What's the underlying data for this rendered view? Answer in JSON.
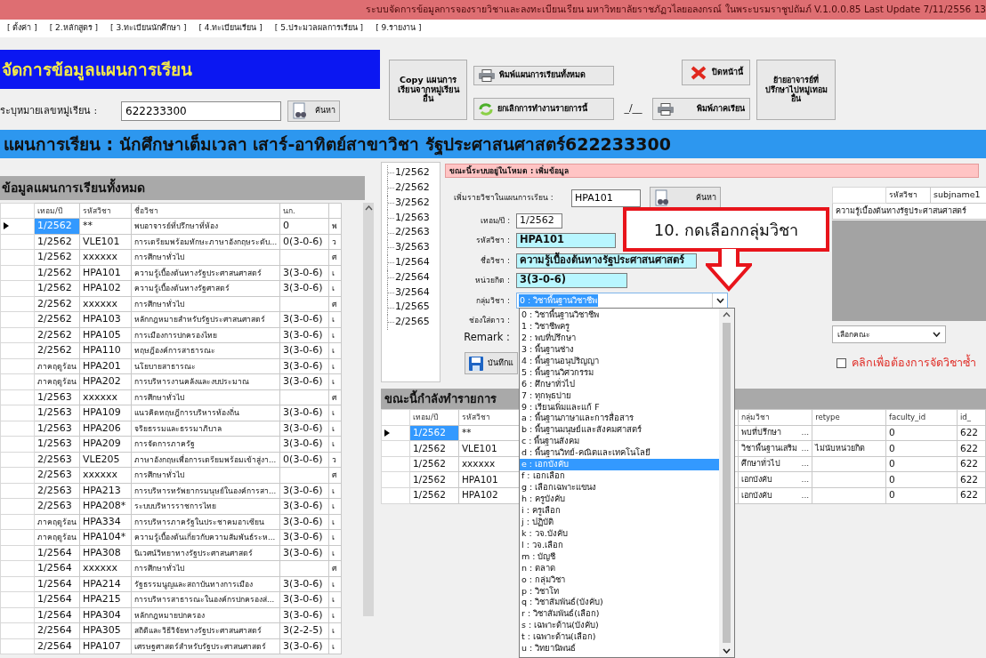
{
  "window": {
    "title": "ระบบจัดการข้อมูลการจองรายวิชาและลงทะเบียนเรียน มหาวิทยาลัยราชภัฏวไลยอลงกรณ์ ในพระบรมราชูปถัมภ์ V.1.0.0.85 Last Update 7/11/2556 13"
  },
  "menu": [
    "[ ตั้งค่า ]",
    "[ 2.หลักสูตร ]",
    "[ 3.ทะเบียนนักศึกษา ]",
    "[ 4.ทะเบียนเรียน ]",
    "[ 5.ประมวลผลการเรียน ]",
    "[ 9.รายงาน ]"
  ],
  "page_title": "จัดการข้อมูลแผนการเรียน",
  "group_search": {
    "label": "ระบุหมายเลขหมู่เรียน :",
    "value": "622233300",
    "button": "ค้นหา"
  },
  "toolbar": [
    {
      "kind": "copy",
      "label": "Copy แผนการเรียนจากหมู่เรียนอื่น"
    },
    {
      "kind": "print_all",
      "label": "พิมพ์แผนการเรียนทั้งหมด"
    },
    {
      "kind": "close",
      "label": "ปิดหน้านี้"
    },
    {
      "kind": "move",
      "label": "ย้ายอาจารย์ที่ปรึกษาไปหมู่เทอมอื่น"
    },
    {
      "kind": "cancel",
      "label": "ยกเลิกการทำงานรายการนี้"
    },
    {
      "kind": "record",
      "label": "_/__"
    },
    {
      "kind": "print_term",
      "label": "พิมพ์ภาคเรียน"
    }
  ],
  "plan_heading": "แผนการเรียน : นักศึกษาเต็มเวลา เสาร์-อาทิตย์สาขาวิชา รัฐประศาสนศาสตร์622233300",
  "all_plans": {
    "title": "ข้อมูลแผนการเรียนทั้งหมด",
    "columns": [
      "เทอม/ปี",
      "รหัสวิชา",
      "ชื่อวิชา",
      "นก."
    ],
    "rows": [
      {
        "selected": true,
        "term": "1/2562",
        "code": "**",
        "name": "พบอาจารย์ที่ปรึกษาที่ห้อง",
        "credits": "0",
        "column_5": "พ"
      },
      {
        "selected": false,
        "term": "1/2562",
        "code": "VLE101",
        "name": "การเตรียมพร้อมทักษะภาษาอังกฤษระดับ...",
        "credits": "0(3-0-6)",
        "column_5": "ว"
      },
      {
        "selected": false,
        "term": "1/2562",
        "code": "xxxxxx",
        "name": "การศึกษาทั่วไป",
        "column_5": "ศ"
      },
      {
        "selected": false,
        "term": "1/2562",
        "code": "HPA101",
        "name": "ความรู้เบื้องต้นทางรัฐประศาสนศาสตร์",
        "credits": "3(3-0-6)",
        "column_5": "เ"
      },
      {
        "selected": false,
        "term": "1/2562",
        "code": "HPA102",
        "name": "ความรู้เบื้องต้นทางรัฐศาสตร์",
        "credits": "3(3-0-6)",
        "column_5": "เ"
      },
      {
        "selected": false,
        "term": "2/2562",
        "code": "xxxxxx",
        "name": "การศึกษาทั่วไป",
        "column_5": "ศ"
      },
      {
        "selected": false,
        "term": "2/2562",
        "code": "HPA103",
        "name": "หลักกฎหมายสำหรับรัฐประศาสนศาสตร์",
        "credits": "3(3-0-6)",
        "column_5": "เ"
      },
      {
        "selected": false,
        "term": "2/2562",
        "code": "HPA105",
        "name": "การเมืองการปกครองไทย",
        "credits": "3(3-0-6)",
        "column_5": "เ"
      },
      {
        "selected": false,
        "term": "2/2562",
        "code": "HPA110",
        "name": "ทฤษฎีองค์การสาธารณะ",
        "credits": "3(3-0-6)",
        "column_5": "เ"
      },
      {
        "selected": false,
        "term": "ภาคฤดูร้อน",
        "code": "HPA201",
        "name": "นโยบายสาธารณะ",
        "credits": "3(3-0-6)",
        "column_5": "เ"
      },
      {
        "selected": false,
        "term": "ภาคฤดูร้อน",
        "code": "HPA202",
        "name": "การบริหารงานคลังและงบประมาณ",
        "credits": "3(3-0-6)",
        "column_5": "เ"
      },
      {
        "selected": false,
        "term": "1/2563",
        "code": "xxxxxx",
        "name": "การศึกษาทั่วไป",
        "column_5": "ศ"
      },
      {
        "selected": false,
        "term": "1/2563",
        "code": "HPA109",
        "name": "แนวคิดทฤษฎีการบริหารท้องถิ่น",
        "credits": "3(3-0-6)",
        "column_5": "เ"
      },
      {
        "selected": false,
        "term": "1/2563",
        "code": "HPA206",
        "name": "จริยธรรมและธรรมาภิบาล",
        "credits": "3(3-0-6)",
        "column_5": "เ"
      },
      {
        "selected": false,
        "term": "1/2563",
        "code": "HPA209",
        "name": "การจัดการภาครัฐ",
        "credits": "3(3-0-6)",
        "column_5": "เ"
      },
      {
        "selected": false,
        "term": "2/2563",
        "code": "VLE205",
        "name": "ภาษาอังกฤษเพื่อการเตรียมพร้อมเข้าสู่งา...",
        "credits": "0(3-0-6)",
        "column_5": "ว"
      },
      {
        "selected": false,
        "term": "2/2563",
        "code": "xxxxxx",
        "name": "การศึกษาทั่วไป",
        "column_5": "ศ"
      },
      {
        "selected": false,
        "term": "2/2563",
        "code": "HPA213",
        "name": "การบริหารทรัพยากรมนุษย์ในองค์การสา...",
        "credits": "3(3-0-6)",
        "column_5": "เ"
      },
      {
        "selected": false,
        "term": "2/2563",
        "code": "HPA208*",
        "name": "ระบบบริหารราชการไทย",
        "credits": "3(3-0-6)",
        "column_5": "เ"
      },
      {
        "selected": false,
        "term": "ภาคฤดูร้อน",
        "code": "HPA334",
        "name": "การบริหารภาครัฐในประชาคมอาเซียน",
        "credits": "3(3-0-6)",
        "column_5": "เ"
      },
      {
        "selected": false,
        "term": "ภาคฤดูร้อน",
        "code": "HPA104*",
        "name": "ความรู้เบื้องต้นเกี่ยวกับความสัมพันธ์ระห...",
        "credits": "3(3-0-6)",
        "column_5": "เ"
      },
      {
        "selected": false,
        "term": "1/2564",
        "code": "HPA308",
        "name": "นิเวศน์วิทยาทางรัฐประศาสนศาสตร์",
        "credits": "3(3-0-6)",
        "column_5": "เ"
      },
      {
        "selected": false,
        "term": "1/2564",
        "code": "xxxxxx",
        "name": "การศึกษาทั่วไป",
        "column_5": "ศ"
      },
      {
        "selected": false,
        "term": "1/2564",
        "code": "HPA214",
        "name": "รัฐธรรมนูญและสถาบันทางการเมือง",
        "credits": "3(3-0-6)",
        "column_5": "เ"
      },
      {
        "selected": false,
        "term": "1/2564",
        "code": "HPA215",
        "name": "การบริหารสาธารณะในองค์กรปกครองส่...",
        "credits": "3(3-0-6)",
        "column_5": "เ"
      },
      {
        "selected": false,
        "term": "1/2564",
        "code": "HPA304",
        "name": "หลักกฎหมายปกครอง",
        "credits": "3(3-0-6)",
        "column_5": "เ"
      },
      {
        "selected": false,
        "term": "2/2564",
        "code": "HPA305",
        "name": "สถิติและวิธีวิจัยทางรัฐประศาสนศาสตร์",
        "credits": "3(2-2-5)",
        "column_5": "เ"
      },
      {
        "selected": false,
        "term": "2/2564",
        "code": "HPA107",
        "name": "เศรษฐศาสตร์สำหรับรัฐประศาสนศาสตร์",
        "credits": "3(3-0-6)",
        "column_5": "เ"
      }
    ]
  },
  "terms": [
    "1/2562",
    "2/2562",
    "3/2562",
    "1/2563",
    "2/2563",
    "3/2563",
    "1/2564",
    "2/2564",
    "3/2564",
    "1/2565",
    "2/2565"
  ],
  "mode_status": "ขณะนี้ระบบอยู่ในโหมด : เพิ่มข้อมูล",
  "form": {
    "add_label": "เพิ่มรายวิชาในแผนการเรียน :",
    "add_value": "HPA101",
    "search_button": "ค้นหา",
    "fields": [
      {
        "kind": "text",
        "label": "เทอม/ปี :",
        "value": "1/2562"
      },
      {
        "kind": "highlight",
        "label": "รหัสวิชา :",
        "value": "HPA101"
      },
      {
        "kind": "highlight",
        "label": "ชื่อวิชา :",
        "value": "ความรู้เบื้องต้นทางรัฐประศาสนศาสตร์"
      },
      {
        "kind": "highlight",
        "label": "หน่วยกิต :",
        "value": "3(3-0-6)"
      },
      {
        "kind": "select",
        "label": "กลุ่มวิชา :",
        "value": "0 : วิชาพื้นฐานวิชาชีพ"
      },
      {
        "kind": "label",
        "label": "ช่องใส่ดาว :"
      },
      {
        "kind": "label",
        "label": "Remark :"
      }
    ],
    "save_button": "บันทึกแ"
  },
  "subject_lookup": {
    "columns": [
      "รหัสวิชา",
      "subjname1"
    ],
    "row": "ความรู้เบื้องต้นทางรัฐประศาสนศาสตร์"
  },
  "faculty_select": {
    "value": "เลือกคณะ"
  },
  "duplicate_option": {
    "label": "คลิกเพื่อต้องการจัดวิชาซ้ำ",
    "checked": false
  },
  "current_items": {
    "title": "ขณะนี้กำลังทำรายการ",
    "columns": [
      "เทอม/ปี",
      "รหัสวิชา",
      "กลุ่มวิชา",
      "retype",
      "faculty_id",
      "id_"
    ],
    "rows": [
      {
        "selected": true,
        "term": "1/2562",
        "code": "**",
        "group": "พบที่ปรึกษา",
        "more": "...",
        "faculty_id": "0",
        "id": "622"
      },
      {
        "selected": false,
        "term": "1/2562",
        "code": "VLE101",
        "group": "วิชาพื้นฐานเสริม",
        "more": "...",
        "retype": "ไม่นับหน่วยกิต",
        "faculty_id": "0",
        "id": "622"
      },
      {
        "selected": false,
        "term": "1/2562",
        "code": "xxxxxx",
        "group": "ศึกษาทั่วไป",
        "more": "...",
        "faculty_id": "0",
        "id": "622"
      },
      {
        "selected": false,
        "term": "1/2562",
        "code": "HPA101",
        "group": "เอกบังคับ",
        "more": "...",
        "faculty_id": "0",
        "id": "622"
      },
      {
        "selected": false,
        "term": "1/2562",
        "code": "HPA102",
        "group": "เอกบังคับ",
        "more": "...",
        "faculty_id": "0",
        "id": "622"
      }
    ]
  },
  "group_options": [
    {
      "label": "0 : วิชาพื้นฐานวิชาชีพ",
      "selected": false
    },
    {
      "label": "1 : วิชาชีพครู",
      "selected": false
    },
    {
      "label": "2 : พบที่ปรึกษา",
      "selected": false
    },
    {
      "label": "3 : พื้นฐานช่าง",
      "selected": false
    },
    {
      "label": "4 : พื้นฐานอนุปริญญา",
      "selected": false
    },
    {
      "label": "5 : พื้นฐานวิศวกรรม",
      "selected": false
    },
    {
      "label": "6 : ศึกษาทั่วไป",
      "selected": false
    },
    {
      "label": "7 : ทุกพุธบ่าย",
      "selected": false
    },
    {
      "label": "9 : เรียนเพิ่มและแก้ F",
      "selected": false
    },
    {
      "label": "a : พื้นฐานภาษาและการสื่อสาร",
      "selected": false
    },
    {
      "label": "b : พื้นฐานมนุษย์และสังคมศาสตร์",
      "selected": false
    },
    {
      "label": "c : พื้นฐานสังคม",
      "selected": false
    },
    {
      "label": "d : พื้นฐานวิทย์-คณิตและเทคโนโลยี",
      "selected": false
    },
    {
      "label": "e : เอกบังคับ",
      "selected": true
    },
    {
      "label": "f : เอกเลือก",
      "selected": false
    },
    {
      "label": "g : เลือกเฉพาะแขนง",
      "selected": false
    },
    {
      "label": "h : ครูบังคับ",
      "selected": false
    },
    {
      "label": "i : ครูเลือก",
      "selected": false
    },
    {
      "label": "j : ปฏิบัติ",
      "selected": false
    },
    {
      "label": "k : วจ.บังคับ",
      "selected": false
    },
    {
      "label": "l : วจ.เลือก",
      "selected": false
    },
    {
      "label": "m : บัญชี",
      "selected": false
    },
    {
      "label": "n : ตลาด",
      "selected": false
    },
    {
      "label": "o : กลุ่มวิชา",
      "selected": false
    },
    {
      "label": "p : วิชาโท",
      "selected": false
    },
    {
      "label": "q : วิชาสัมพันธ์(บังคับ)",
      "selected": false
    },
    {
      "label": "r : วิชาสัมพันธ์(เลือก)",
      "selected": false
    },
    {
      "label": "s : เฉพาะด้าน(บังคับ)",
      "selected": false
    },
    {
      "label": "t : เฉพาะด้าน(เลือก)",
      "selected": false
    },
    {
      "label": "u : วิทยานิพนธ์",
      "selected": false
    }
  ],
  "callout": {
    "text": "10. กดเลือกกลุ่มวิชา"
  }
}
